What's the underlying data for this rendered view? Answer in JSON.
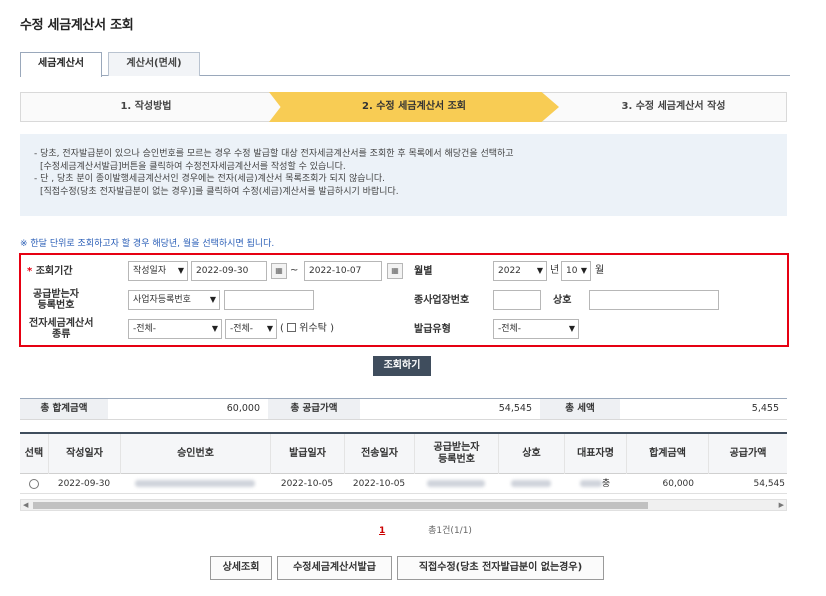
{
  "page_title": "수정 세금계산서 조회",
  "tabs": [
    "세금계산서",
    "계산서(면세)"
  ],
  "steps": [
    "1. 작성방법",
    "2. 수정 세금계산서 조회",
    "3. 수정 세금계산서 작성"
  ],
  "info_lines": [
    "- 당초, 전자발급분이 있으나 승인번호를 모르는 경우 수정 발급할 대상 전자세금계산서를 조회한 후 목록에서 해당건을 선택하고",
    "[수정세금계산서발급]버튼을 클릭하여 수정전자세금계산서를 작성할 수 있습니다.",
    "- 단 , 당초 분이 종이발행세금계산서인 경우에는 전자(세금)계산서 목록조회가 되지 않습니다.",
    "[직접수정(당초 전자발급분이 없는 경우)]를 클릭하여 수정(세금)계산서를 발급하시기 바랍니다."
  ],
  "notice": "※ 한달 단위로 조회하고자 할 경우 해당년, 월을 선택하시면 됩니다.",
  "search": {
    "required_mark": "*",
    "period_label": "조회기간",
    "period_type": "작성일자",
    "date_from": "2022-09-30",
    "tilde": "~",
    "date_to": "2022-10-07",
    "monthly_label": "월별",
    "year": "2022",
    "year_unit": "년",
    "month": "10",
    "month_unit": "월",
    "buyer_label_1": "공급받는자",
    "buyer_label_2": "등록번호",
    "buyer_type": "사업자등록번호",
    "buyer_value": "",
    "branch_label": "종사업장번호",
    "branch_value": "",
    "company_label": "상호",
    "company_value": "",
    "type_label_1": "전자세금계산서",
    "type_label_2": "종류",
    "type_1": "-전체-",
    "type_2": "-전체-",
    "trust_open": "(",
    "trust_label": "위수탁",
    "trust_close": ")",
    "issue_type_label": "발급유형",
    "issue_type": "-전체-",
    "search_button": "조회하기"
  },
  "summary": {
    "total_label": "총 합계금액",
    "total_value": "60,000",
    "supply_label": "총 공급가액",
    "supply_value": "54,545",
    "tax_label": "총 세액",
    "tax_value": "5,455"
  },
  "table": {
    "headers": [
      "선택",
      "작성일자",
      "승인번호",
      "발급일자",
      "전송일자",
      "공급받는자\n등록번호",
      "상호",
      "대표자명",
      "합계금액",
      "공급가액"
    ],
    "rows": [
      {
        "date": "2022-09-30",
        "issue_date": "2022-10-05",
        "send_date": "2022-10-05",
        "ceo_tail": "충",
        "total": "60,000",
        "supply": "54,545"
      }
    ]
  },
  "pager": {
    "current": "1",
    "summary": "총1건(1/1)"
  },
  "buttons": {
    "detail": "상세조회",
    "modify_issue": "수정세금계산서발급",
    "direct_modify": "직접수정(당초 전자발급분이 없는경우)"
  }
}
